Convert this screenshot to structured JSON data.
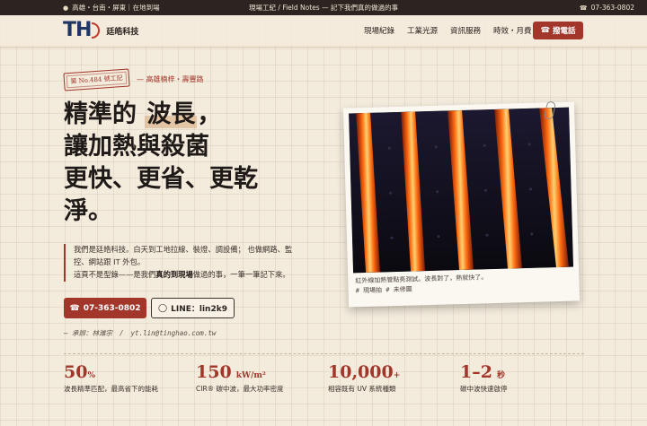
{
  "topbar": {
    "regions": "高雄・台南・屏東｜在地到場",
    "tagline": "現場工紀 / Field Notes — 記下我們真的做過的事",
    "phone": "07-363-0802"
  },
  "brand": {
    "mark": "TH",
    "name": "廷皓科技"
  },
  "nav": {
    "items": [
      "現場紀錄",
      "工業光源",
      "資訊服務",
      "時效・月費"
    ],
    "call_label": "撥電話"
  },
  "hero": {
    "stamp": "第 No.484 號工記",
    "location": "— 高雄楠梓・壽豐路",
    "headline": {
      "line1_prefix": "精準的",
      "line1_highlight": "波長",
      "line1_suffix": "，",
      "line2": "讓加熱與殺菌",
      "line3": "更快、更省、更乾",
      "line4": "淨。"
    },
    "intro_p1": "我們是廷皓科技。白天到工地拉線、裝燈、調設備； 也做網路、監控、網站跟 IT 外包。",
    "intro_p2_prefix": "這頁不是型錄——是我們",
    "intro_p2_bold": "真的到現場",
    "intro_p2_suffix": "做過的事，一筆一筆記下來。",
    "phone_button": "07-363-0802",
    "line_button": "LINE：lin2k9",
    "signature_name": "— 承辦：林濰宗",
    "signature_email": "yt.lin@tinghao.com.tw"
  },
  "photo": {
    "caption_line1": "紅外線加熱管點亮測試。波長對了，熱就快了。",
    "caption_line2": "# 現場拍 # 未修圖"
  },
  "stats": [
    {
      "value": "50",
      "unit": "%",
      "label": "波長精準匹配，最高省下的能耗"
    },
    {
      "value": "150",
      "unit": "kW/m²",
      "label": "CIR® 碳中波，最大功率密度"
    },
    {
      "value": "10,000",
      "unit": "+",
      "label": "相容既有 UV 系統種類"
    },
    {
      "value": "1–2",
      "unit": "秒",
      "label": "碳中波快速啟停"
    }
  ],
  "colors": {
    "accent": "#a2362a",
    "ink": "#2b2420",
    "paper": "#f3ebdc",
    "brand_blue": "#1f3564"
  }
}
